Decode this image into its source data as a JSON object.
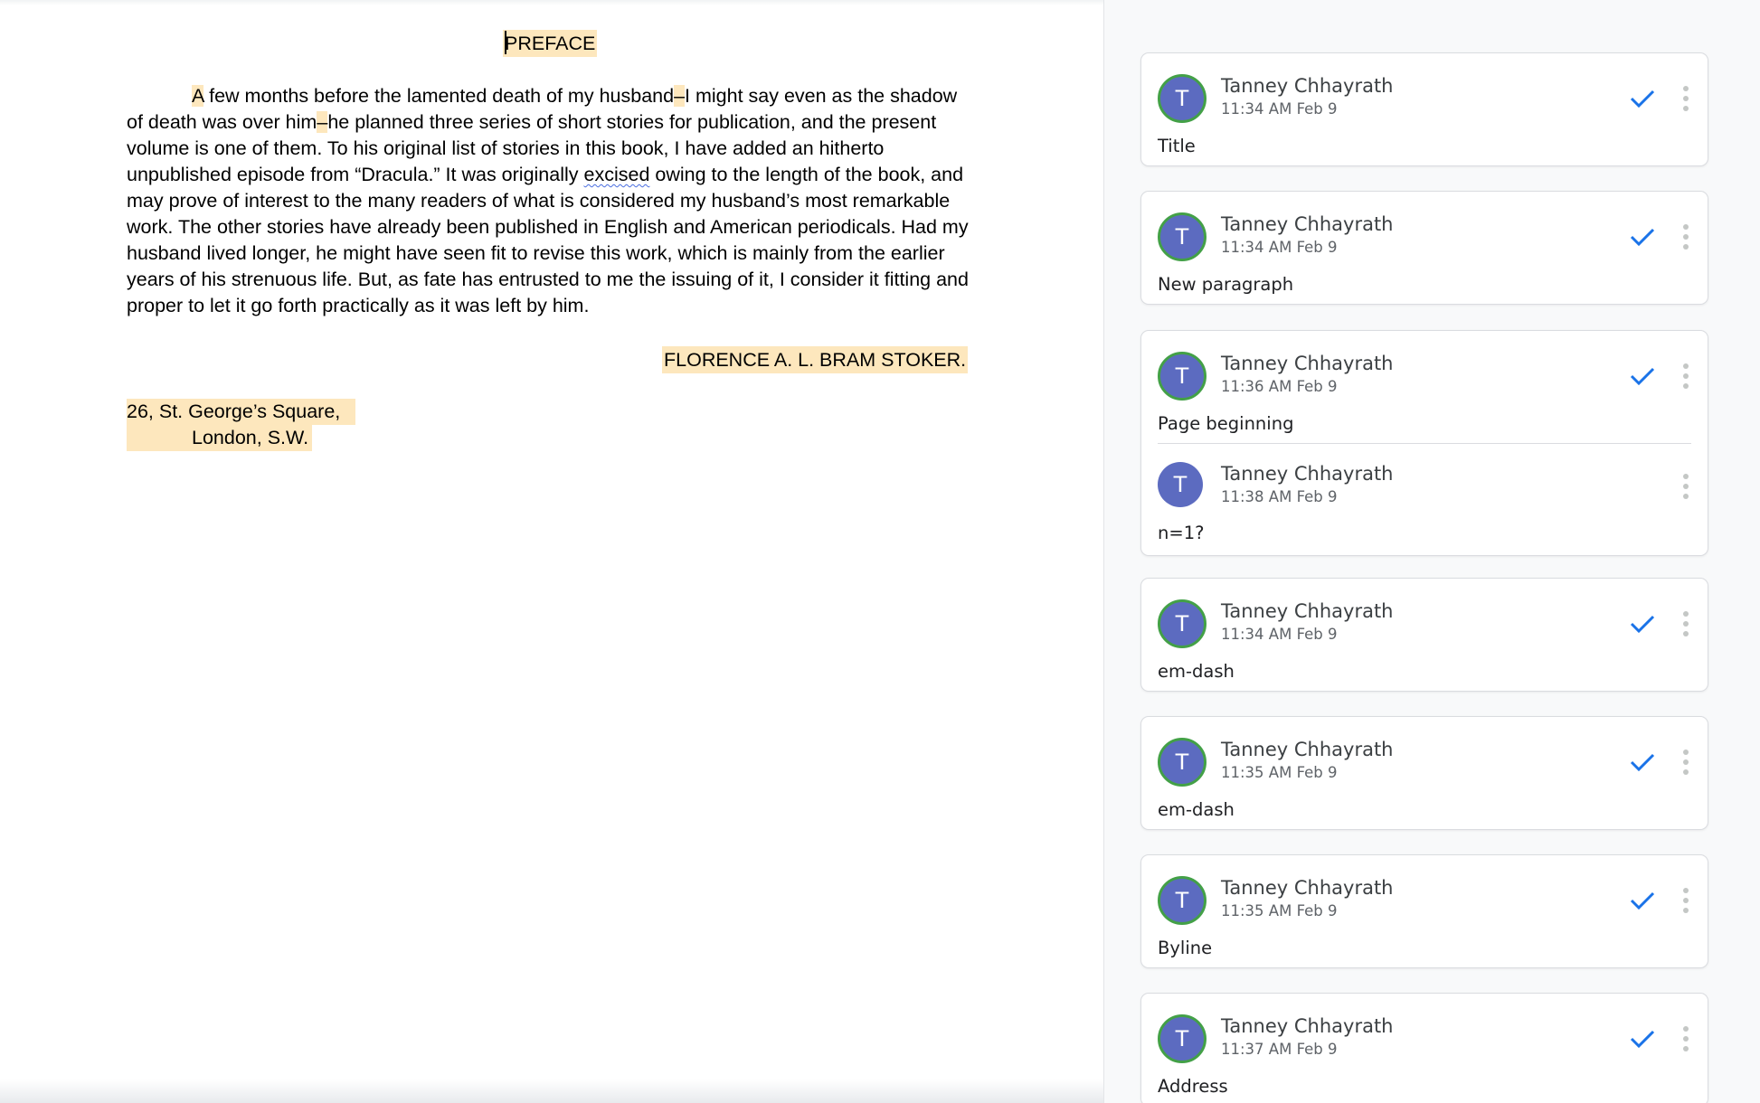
{
  "document": {
    "title": "PREFACE",
    "body": {
      "highlight_start": "A",
      "s1": " few months before the lamented death of my husband",
      "dash1": "–",
      "s2": "I might say even as the shadow of death was over him",
      "dash2": "–",
      "s3": "he planned three series of short stories for publication, and the present volume is one of them. To his original list of stories in this book, I have added an hitherto unpublished episode from “Dracula.” It was originally ",
      "misspelled": "excised",
      "s4": " owing to the length of the book, and may prove of interest to the many readers of what is considered my husband’s most remarkable work. The other stories have already been published in English and American periodicals. Had my husband lived longer, he might have seen fit to revise this work, which is mainly from the earlier years of his strenuous life. But, as fate has entrusted to me the issuing of it, I consider it fitting and proper to let it go forth practically as it was left by him."
    },
    "byline": "FLORENCE A. L. BRAM STOKER.",
    "address_line1": "26, St. George’s Square,",
    "address_line2": "London, S.W."
  },
  "comments": [
    {
      "initial": "T",
      "author": "Tanney Chhayrath",
      "time": "11:34 AM Feb 9",
      "text": "Title",
      "resolve_icon": "check-icon",
      "menu_icon": "more-vert-icon"
    },
    {
      "initial": "T",
      "author": "Tanney Chhayrath",
      "time": "11:34 AM Feb 9",
      "text": "New paragraph",
      "resolve_icon": "check-icon",
      "menu_icon": "more-vert-icon"
    },
    {
      "initial": "T",
      "author": "Tanney Chhayrath",
      "time": "11:36 AM Feb 9",
      "text": "Page beginning",
      "resolve_icon": "check-icon",
      "menu_icon": "more-vert-icon",
      "reply": {
        "initial": "T",
        "author": "Tanney Chhayrath",
        "time": "11:38 AM Feb 9",
        "text": "n=1?",
        "menu_icon": "more-vert-icon"
      }
    },
    {
      "initial": "T",
      "author": "Tanney Chhayrath",
      "time": "11:34 AM Feb 9",
      "text": "em-dash",
      "resolve_icon": "check-icon",
      "menu_icon": "more-vert-icon"
    },
    {
      "initial": "T",
      "author": "Tanney Chhayrath",
      "time": "11:35 AM Feb 9",
      "text": "em-dash",
      "resolve_icon": "check-icon",
      "menu_icon": "more-vert-icon"
    },
    {
      "initial": "T",
      "author": "Tanney Chhayrath",
      "time": "11:35 AM Feb 9",
      "text": "Byline",
      "resolve_icon": "check-icon",
      "menu_icon": "more-vert-icon"
    },
    {
      "initial": "T",
      "author": "Tanney Chhayrath",
      "time": "11:37 AM Feb 9",
      "text": "Address",
      "resolve_icon": "check-icon",
      "menu_icon": "more-vert-icon"
    }
  ],
  "colors": {
    "highlight": "#fde7bd",
    "avatar": "#5c6bc0",
    "avatar_ring": "#43a047",
    "resolve_check": "#1a73e8"
  }
}
